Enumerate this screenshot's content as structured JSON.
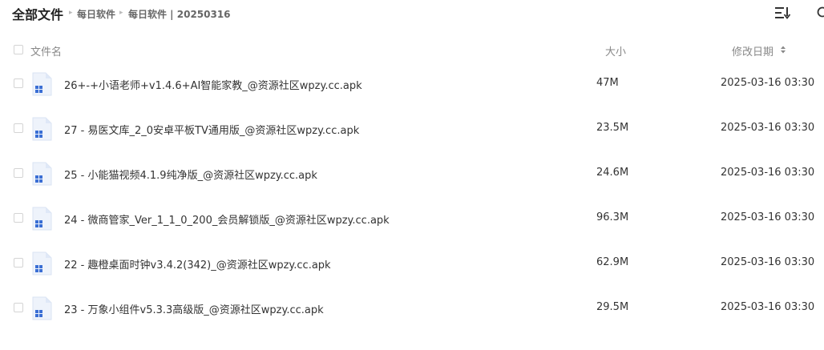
{
  "breadcrumb": {
    "root": "全部文件",
    "items": [
      "每日软件",
      "每日软件 | 20250316"
    ],
    "separator": "▸"
  },
  "toolbar": {
    "view_toggle_icon": "list-view-icon",
    "partial_icon": "search-icon"
  },
  "header": {
    "name": "文件名",
    "size": "大小",
    "modified": "修改日期",
    "sort_icon": "sort-icon"
  },
  "files": [
    {
      "name": "26+-+小语老师+v1.4.6+AI智能家教_@资源社区wpzy.cc.apk",
      "size": "47M",
      "modified": "2025-03-16 03:30",
      "icon": "apk-file-icon"
    },
    {
      "name": "27 - 易医文库_2_0安卓平板TV通用版_@资源社区wpzy.cc.apk",
      "size": "23.5M",
      "modified": "2025-03-16 03:30",
      "icon": "apk-file-icon"
    },
    {
      "name": "25 - 小能猫视频4.1.9纯净版_@资源社区wpzy.cc.apk",
      "size": "24.6M",
      "modified": "2025-03-16 03:30",
      "icon": "apk-file-icon"
    },
    {
      "name": "24 - 微商管家_Ver_1_1_0_200_会员解锁版_@资源社区wpzy.cc.apk",
      "size": "96.3M",
      "modified": "2025-03-16 03:30",
      "icon": "apk-file-icon"
    },
    {
      "name": "22 - 趣橙桌面时钟v3.4.2(342)_@资源社区wpzy.cc.apk",
      "size": "62.9M",
      "modified": "2025-03-16 03:30",
      "icon": "apk-file-icon"
    },
    {
      "name": "23 - 万象小组件v5.3.3高级版_@资源社区wpzy.cc.apk",
      "size": "29.5M",
      "modified": "2025-03-16 03:30",
      "icon": "apk-file-icon"
    }
  ],
  "colors": {
    "text": "#333333",
    "muted": "#888888",
    "icon_blue": "#3b6fd4",
    "icon_bg": "#eef3fb"
  }
}
